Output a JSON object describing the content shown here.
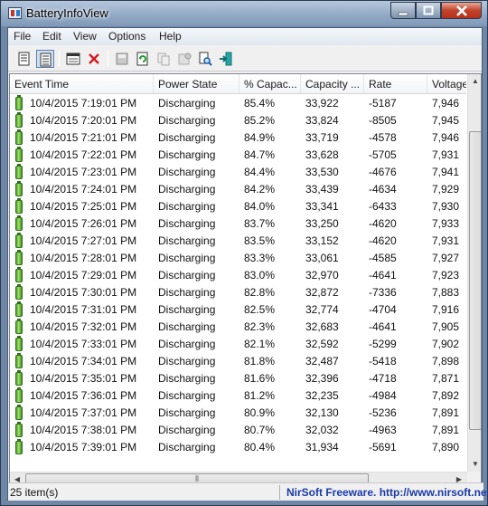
{
  "window": {
    "title": "BatteryInfoView"
  },
  "menu": [
    "File",
    "Edit",
    "View",
    "Options",
    "Help"
  ],
  "columns": [
    "Event Time",
    "Power State",
    "% Capac...",
    "Capacity ...",
    "Rate",
    "Voltage"
  ],
  "rows": [
    [
      "10/4/2015 7:19:01 PM",
      "Discharging",
      "85.4%",
      "33,922",
      "-5187",
      "7,946"
    ],
    [
      "10/4/2015 7:20:01 PM",
      "Discharging",
      "85.2%",
      "33,824",
      "-8505",
      "7,945"
    ],
    [
      "10/4/2015 7:21:01 PM",
      "Discharging",
      "84.9%",
      "33,719",
      "-4578",
      "7,946"
    ],
    [
      "10/4/2015 7:22:01 PM",
      "Discharging",
      "84.7%",
      "33,628",
      "-5705",
      "7,931"
    ],
    [
      "10/4/2015 7:23:01 PM",
      "Discharging",
      "84.4%",
      "33,530",
      "-4676",
      "7,941"
    ],
    [
      "10/4/2015 7:24:01 PM",
      "Discharging",
      "84.2%",
      "33,439",
      "-4634",
      "7,929"
    ],
    [
      "10/4/2015 7:25:01 PM",
      "Discharging",
      "84.0%",
      "33,341",
      "-6433",
      "7,930"
    ],
    [
      "10/4/2015 7:26:01 PM",
      "Discharging",
      "83.7%",
      "33,250",
      "-4620",
      "7,933"
    ],
    [
      "10/4/2015 7:27:01 PM",
      "Discharging",
      "83.5%",
      "33,152",
      "-4620",
      "7,931"
    ],
    [
      "10/4/2015 7:28:01 PM",
      "Discharging",
      "83.3%",
      "33,061",
      "-4585",
      "7,927"
    ],
    [
      "10/4/2015 7:29:01 PM",
      "Discharging",
      "83.0%",
      "32,970",
      "-4641",
      "7,923"
    ],
    [
      "10/4/2015 7:30:01 PM",
      "Discharging",
      "82.8%",
      "32,872",
      "-7336",
      "7,883"
    ],
    [
      "10/4/2015 7:31:01 PM",
      "Discharging",
      "82.5%",
      "32,774",
      "-4704",
      "7,916"
    ],
    [
      "10/4/2015 7:32:01 PM",
      "Discharging",
      "82.3%",
      "32,683",
      "-4641",
      "7,905"
    ],
    [
      "10/4/2015 7:33:01 PM",
      "Discharging",
      "82.1%",
      "32,592",
      "-5299",
      "7,902"
    ],
    [
      "10/4/2015 7:34:01 PM",
      "Discharging",
      "81.8%",
      "32,487",
      "-5418",
      "7,898"
    ],
    [
      "10/4/2015 7:35:01 PM",
      "Discharging",
      "81.6%",
      "32,396",
      "-4718",
      "7,871"
    ],
    [
      "10/4/2015 7:36:01 PM",
      "Discharging",
      "81.2%",
      "32,235",
      "-4984",
      "7,892"
    ],
    [
      "10/4/2015 7:37:01 PM",
      "Discharging",
      "80.9%",
      "32,130",
      "-5236",
      "7,891"
    ],
    [
      "10/4/2015 7:38:01 PM",
      "Discharging",
      "80.7%",
      "32,032",
      "-4963",
      "7,891"
    ],
    [
      "10/4/2015 7:39:01 PM",
      "Discharging",
      "80.4%",
      "31,934",
      "-5691",
      "7,890"
    ]
  ],
  "status": {
    "count": "25 item(s)",
    "link": "NirSoft Freeware.  http://www.nirsoft.net"
  }
}
